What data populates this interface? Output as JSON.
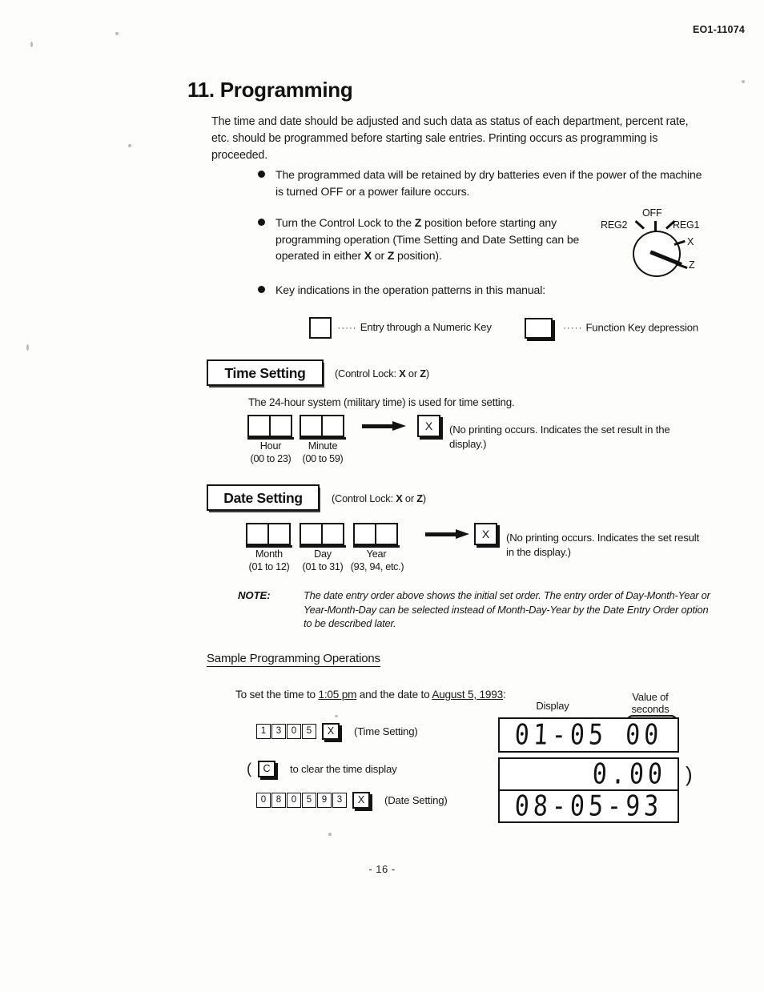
{
  "header": {
    "doc_code": "EO1-11074"
  },
  "title": "11. Programming",
  "intro": "The time and date should be adjusted and such data as status of each department, percent rate, etc. should be programmed before starting sale entries.  Printing occurs as programming is proceeded.",
  "bullets": [
    {
      "text": "The programmed data will be retained by dry batteries even if the power of the machine is turned OFF or a power failure occurs."
    },
    {
      "text_1": "Turn the Control Lock to the ",
      "bold_1": "Z",
      "text_2": " position before starting any programming operation (Time Setting and Date Setting can be operated in either ",
      "bold_2": "X",
      "text_3": " or ",
      "bold_3": "Z",
      "text_4": " position)."
    },
    {
      "text": "Key indications in the operation patterns in this manual:"
    }
  ],
  "control_lock": {
    "labels": {
      "off": "OFF",
      "reg2": "REG2",
      "reg1": "REG1",
      "x": "X",
      "z": "Z"
    },
    "pointing_at": "Z"
  },
  "legend": {
    "dots": "·····",
    "numeric_key_caption": "Entry through a Numeric Key",
    "function_key_caption": "Function Key depression"
  },
  "time_setting": {
    "plate": "Time Setting",
    "control_lock_pre": "(Control Lock: ",
    "control_lock_x": "X",
    "control_lock_mid": " or ",
    "control_lock_z": "Z",
    "control_lock_post": ")",
    "description": "The 24-hour system (military time) is used for time setting.",
    "groups": [
      {
        "boxes": 2,
        "caption": "Hour",
        "range": "(00 to 23)"
      },
      {
        "boxes": 2,
        "caption": "Minute",
        "range": "(00 to 59)"
      }
    ],
    "result_key": "X",
    "result_text": "(No printing occurs.  Indicates the set result in the display.)"
  },
  "date_setting": {
    "plate": "Date Setting",
    "control_lock_pre": "(Control Lock: ",
    "control_lock_x": "X",
    "control_lock_mid": " or ",
    "control_lock_z": "Z",
    "control_lock_post": ")",
    "groups": [
      {
        "boxes": 2,
        "caption": "Month",
        "range": "(01 to 12)"
      },
      {
        "boxes": 2,
        "caption": "Day",
        "range": "(01 to 31)"
      },
      {
        "boxes": 2,
        "caption": "Year",
        "range": "(93, 94, etc.)"
      }
    ],
    "result_key": "X",
    "result_text": "(No printing occurs.  Indicates the set result in the display.)"
  },
  "note": {
    "label": "NOTE:",
    "body": "The date entry order above shows the initial set order.  The entry order of Day-Month-Year or Year-Month-Day can be selected instead of Month-Day-Year by the Date Entry Order option to be described later."
  },
  "sample": {
    "heading": "Sample Programming Operations",
    "sub_pre": "To set the time to ",
    "sub_time": "1:05 pm",
    "sub_mid": " and the date to ",
    "sub_date": "August 5, 1993",
    "sub_post": ":",
    "display_label": "Display",
    "seconds_label": "Value of\nseconds",
    "rows": [
      {
        "name": "time-setting-sequence",
        "numeric_keys": [
          "1",
          "3",
          "0",
          "5"
        ],
        "function_key": "X",
        "caption": "(Time Setting)",
        "lcd": "01-05 00",
        "open_paren": "",
        "close_paren": ""
      },
      {
        "name": "clear-sequence",
        "numeric_keys": [],
        "function_key": "C",
        "caption": "to clear the time display",
        "lcd": "0.00",
        "open_paren": "(",
        "close_paren": ")"
      },
      {
        "name": "date-setting-sequence",
        "numeric_keys": [
          "0",
          "8",
          "0",
          "5",
          "9",
          "3"
        ],
        "function_key": "X",
        "caption": "(Date Setting)",
        "lcd": "08-05-93",
        "open_paren": "",
        "close_paren": ""
      }
    ]
  },
  "page_number": "- 16 -"
}
